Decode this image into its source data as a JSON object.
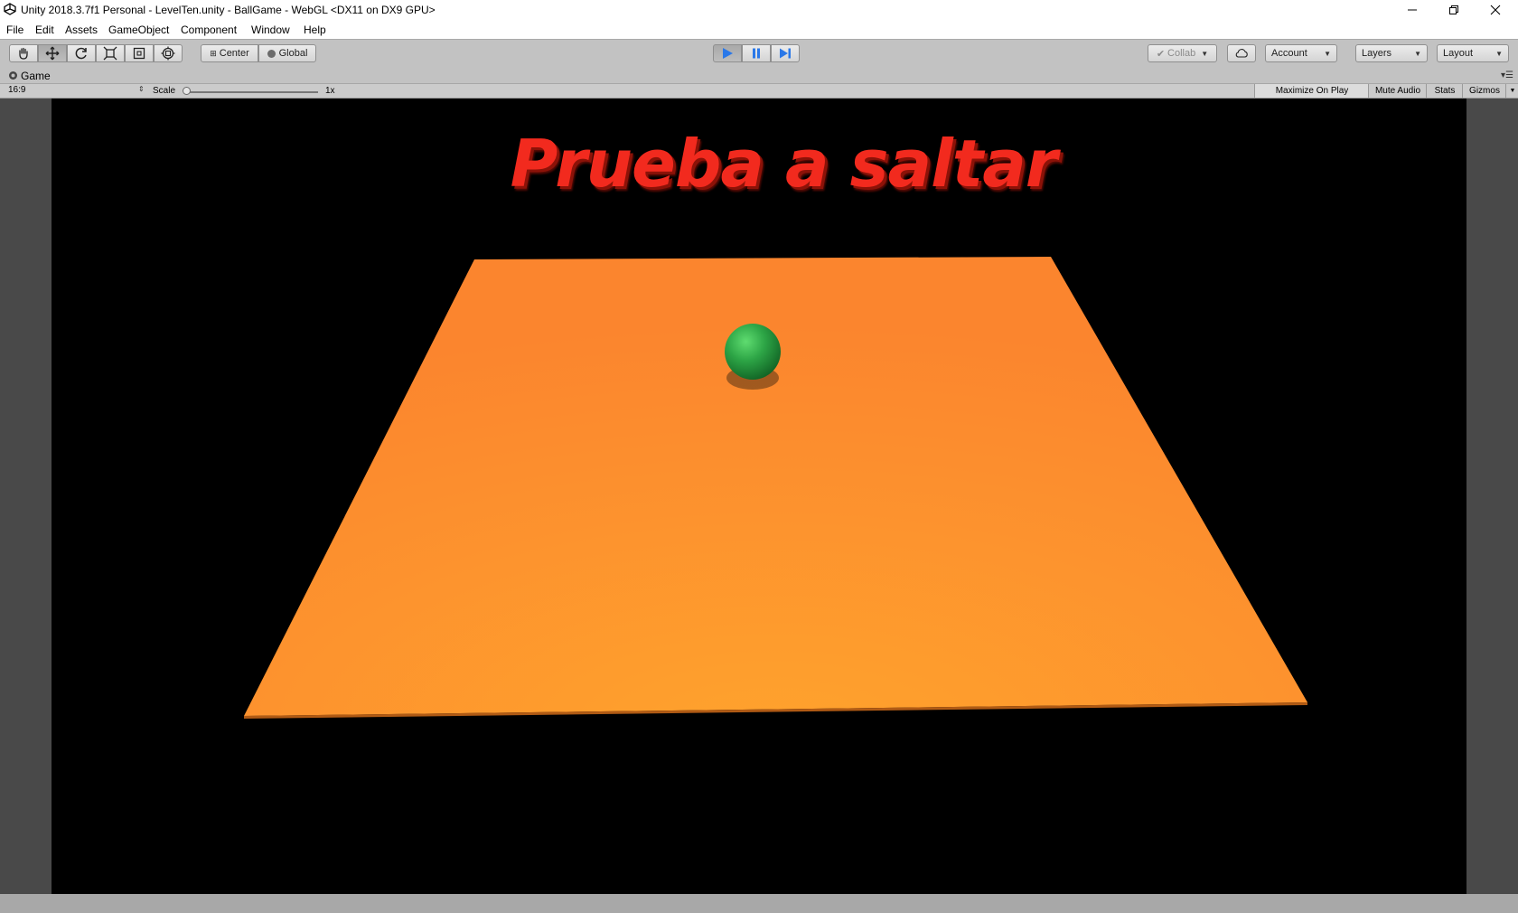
{
  "window": {
    "title": "Unity 2018.3.7f1 Personal - LevelTen.unity - BallGame - WebGL <DX11 on DX9 GPU>",
    "controls": [
      "minimize-icon",
      "restore-icon",
      "close-icon"
    ]
  },
  "menu": {
    "items": [
      "File",
      "Edit",
      "Assets",
      "GameObject",
      "Component",
      "Window",
      "Help"
    ]
  },
  "toolbar": {
    "tools": [
      "hand-icon",
      "move-icon",
      "rotate-icon",
      "scale-icon",
      "rect-icon",
      "transform-icon"
    ],
    "active_tool": "move-icon",
    "pivot_mode": "Center",
    "pivot_rotation": "Global",
    "play_state": "playing",
    "collab_label": "Collab",
    "account_label": "Account",
    "layers_label": "Layers",
    "layout_label": "Layout"
  },
  "game_tab": {
    "label": "Game",
    "aspect": "16:9",
    "scale_label": "Scale",
    "scale_value": "1x",
    "buttons": {
      "maximize_on_play": "Maximize On Play",
      "mute_audio": "Mute Audio",
      "stats": "Stats",
      "gizmos": "Gizmos"
    }
  },
  "scene": {
    "title_text": "Prueba a saltar",
    "colors": {
      "title": "#f22a1e",
      "platform": "#ff9a2e",
      "ball": "#2fa84a",
      "background": "#000000"
    }
  }
}
